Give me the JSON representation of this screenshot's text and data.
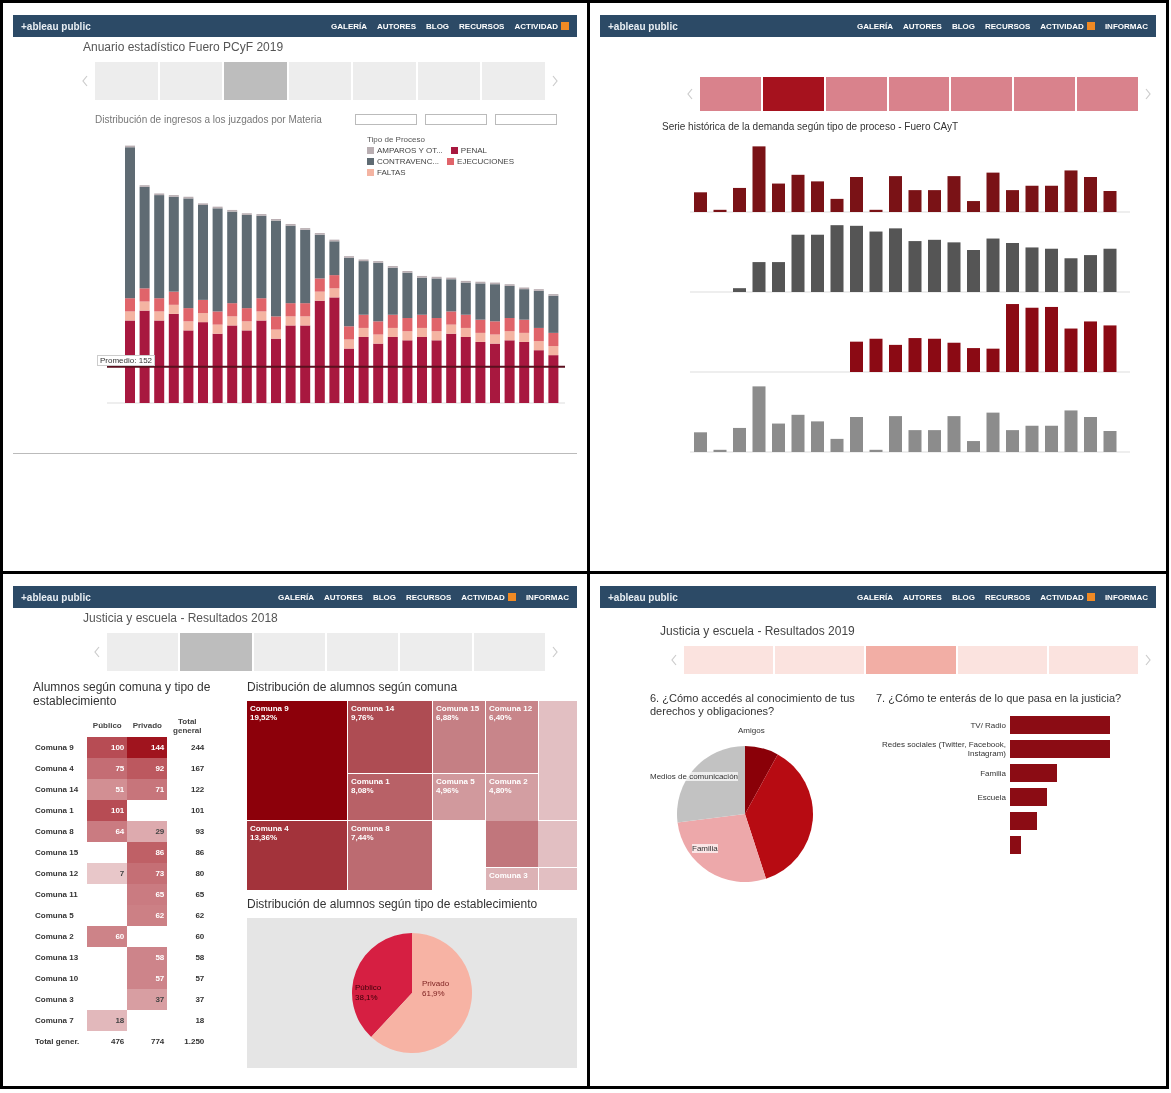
{
  "pcyf_2019": {
    "navbar": {
      "logo": "+ableau public",
      "items": [
        "GALERÍA",
        "AUTORES",
        "BLOG",
        "RECURSOS",
        "ACTIVIDAD"
      ]
    },
    "title": "Anuario estadístico Fuero PCyF 2019",
    "tabs": [
      {
        "selected": false
      },
      {
        "selected": false
      },
      {
        "selected": true
      },
      {
        "selected": false
      },
      {
        "selected": false
      },
      {
        "selected": false
      },
      {
        "selected": false
      }
    ],
    "chart_title": "Distribución de ingresos a los juzgados por Materia",
    "legend": {
      "title": "Tipo de Proceso",
      "items": [
        {
          "label": "AMPAROS Y OT...",
          "color": "#b9aeb2"
        },
        {
          "label": "PENAL",
          "color": "#a8183f"
        },
        {
          "label": "CONTRAVENC...",
          "color": "#5f6b73"
        },
        {
          "label": "EJECUCIONES",
          "color": "#e0646a"
        },
        {
          "label": "FALTAS",
          "color": "#f4b4a2"
        }
      ]
    },
    "average_label": "Promedio: 152"
  },
  "cayt_series": {
    "navbar": {
      "logo": "+ableau public",
      "items": [
        "GALERÍA",
        "AUTORES",
        "BLOG",
        "RECURSOS",
        "ACTIVIDAD",
        "INFORMAC"
      ]
    },
    "tabs": [
      {
        "selected": false
      },
      {
        "selected": true
      },
      {
        "selected": false
      },
      {
        "selected": false
      },
      {
        "selected": false
      },
      {
        "selected": false
      },
      {
        "selected": false
      }
    ],
    "chart_title": "Serie histórica de la demanda según tipo de proceso - Fuero CAyT"
  },
  "escuela_2018": {
    "navbar": {
      "logo": "+ableau public",
      "items": [
        "GALERÍA",
        "AUTORES",
        "BLOG",
        "RECURSOS",
        "ACTIVIDAD",
        "INFORMAC"
      ]
    },
    "title": "Justicia y escuela - Resultados 2018",
    "tabs": [
      {
        "selected": false
      },
      {
        "selected": true
      },
      {
        "selected": false
      },
      {
        "selected": false
      },
      {
        "selected": false
      },
      {
        "selected": false
      }
    ],
    "table": {
      "title": "Alumnos según comuna y tipo de establecimiento",
      "columns": [
        "Público",
        "Privado",
        "Total general"
      ],
      "rows": [
        {
          "label": "Comuna 9",
          "cells": [
            "100",
            "144",
            "244"
          ]
        },
        {
          "label": "Comuna 4",
          "cells": [
            "75",
            "92",
            "167"
          ]
        },
        {
          "label": "Comuna 14",
          "cells": [
            "51",
            "71",
            "122"
          ]
        },
        {
          "label": "Comuna 1",
          "cells": [
            "101",
            "",
            "101"
          ]
        },
        {
          "label": "Comuna 8",
          "cells": [
            "64",
            "29",
            "93"
          ]
        },
        {
          "label": "Comuna 15",
          "cells": [
            "",
            "86",
            "86"
          ]
        },
        {
          "label": "Comuna 12",
          "cells": [
            "7",
            "73",
            "80"
          ]
        },
        {
          "label": "Comuna 11",
          "cells": [
            "",
            "65",
            "65"
          ]
        },
        {
          "label": "Comuna 5",
          "cells": [
            "",
            "62",
            "62"
          ]
        },
        {
          "label": "Comuna 2",
          "cells": [
            "60",
            "",
            "60"
          ]
        },
        {
          "label": "Comuna 13",
          "cells": [
            "",
            "58",
            "58"
          ]
        },
        {
          "label": "Comuna 10",
          "cells": [
            "",
            "57",
            "57"
          ]
        },
        {
          "label": "Comuna 3",
          "cells": [
            "",
            "37",
            "37"
          ]
        },
        {
          "label": "Comuna 7",
          "cells": [
            "18",
            "",
            "18"
          ]
        }
      ],
      "total": {
        "label": "Total gener.",
        "cells": [
          "476",
          "774",
          "1.250"
        ]
      }
    },
    "treemap": {
      "title": "Distribución de alumnos según comuna",
      "tiles": [
        {
          "name": "Comuna 9",
          "share": "19,52%"
        },
        {
          "name": "Comuna 4",
          "share": "13,36%"
        },
        {
          "name": "Comuna 14",
          "share": "9,76%"
        },
        {
          "name": "Comuna 1",
          "share": "8,08%"
        },
        {
          "name": "Comuna 8",
          "share": "7,44%"
        },
        {
          "name": "Comuna 15",
          "share": "6,88%"
        },
        {
          "name": "Comuna 12",
          "share": "6,40%"
        },
        {
          "name": "Comuna 5",
          "share": "4,96%"
        },
        {
          "name": "Comuna 2",
          "share": "4,80%"
        },
        {
          "name": "Comuna 3"
        }
      ]
    },
    "pie": {
      "title": "Distribución de alumnos según tipo de establecimiento",
      "chart_data": {
        "type": "pie",
        "categories": [
          "Público",
          "Privado"
        ],
        "series": [
          {
            "values": [
              38.1,
              61.9
            ]
          }
        ],
        "value_labels": [
          "38,1%",
          "61,9%"
        ]
      }
    }
  },
  "escuela_2019": {
    "navbar": {
      "logo": "+ableau public",
      "items": [
        "GALERÍA",
        "AUTORES",
        "BLOG",
        "RECURSOS",
        "ACTIVIDAD",
        "INFORMAC"
      ]
    },
    "title": "Justicia y escuela - Resultados 2019",
    "tabs": [
      {
        "selected": false
      },
      {
        "selected": false
      },
      {
        "selected": true
      },
      {
        "selected": false
      },
      {
        "selected": false
      }
    ],
    "question_6": {
      "title": "6. ¿Cómo accedés al conocimiento de tus derechos y obligaciones?",
      "labels": [
        "Amigos",
        "Medios de comunicación",
        "Familia"
      ]
    },
    "question_7": {
      "title": "7. ¿Cómo te enterás de lo que pasa en la justicia?",
      "bars": [
        {
          "label": "TV/ Radio"
        },
        {
          "label": "Redes sociales (Twitter, Facebook, Instagram)"
        },
        {
          "label": "Familia"
        },
        {
          "label": "Escuela"
        }
      ]
    }
  }
}
